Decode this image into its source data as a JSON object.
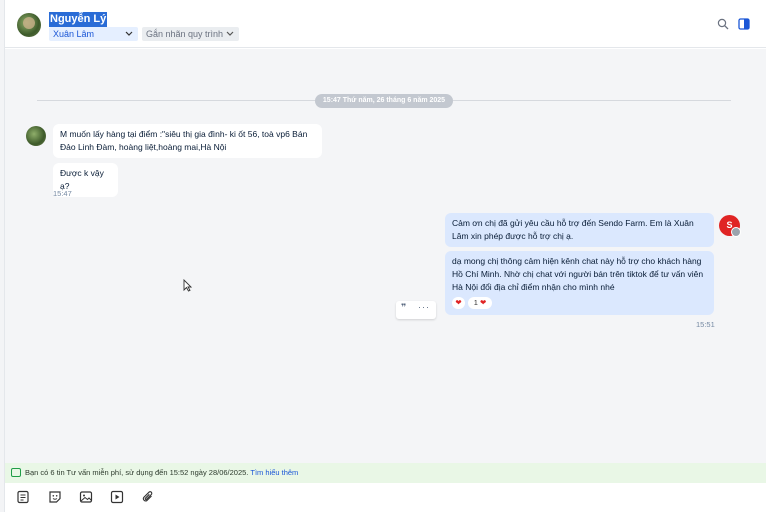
{
  "header": {
    "contact_name": "Nguyễn Lý",
    "assignee": "Xuân Lâm",
    "tag_placeholder": "Gắn nhãn quy trình"
  },
  "chat": {
    "date_separator": "15:47 Thứ năm, 26 tháng 6 năm 2025",
    "incoming": {
      "messages": [
        "M muốn lấy hàng tại điểm :\"siêu thị gia đình- ki ốt 56, toà vp6 Bán Đảo Linh Đàm, hoàng liệt,hoàng mai,Hà Nội",
        "Được k vậy ạ?"
      ],
      "time": "15:47"
    },
    "outgoing": {
      "avatar_text": "S",
      "messages": [
        "Cảm ơn chị đã gửi yêu cầu hỗ trợ đến Sendo Farm. Em là Xuân Lâm xin phép được hỗ trợ chị ạ.",
        "dạ mong chị thông cảm hiện kênh chat này hỗ trợ cho khách hàng Hồ Chí Minh. Nhờ chị chat với người bán trên tiktok để tư vấn viên Hà Nội đổi địa chỉ điểm nhận cho mình nhé"
      ],
      "reaction_count": "1",
      "time": "15:51"
    }
  },
  "notice": {
    "text": "Bạn có 6 tin Tư vấn miễn phí, sử dụng đến 15:52 ngày 28/06/2025.",
    "link": "Tìm hiểu thêm"
  },
  "colors": {
    "accent": "#1a56d6",
    "outgoing_bubble": "#dbe8fe",
    "background": "#f4f5f7",
    "notice_bg": "#e9f7e6"
  },
  "icons": [
    "search-icon",
    "panel-toggle-icon",
    "quote-icon",
    "more-icon",
    "heart-icon",
    "note-icon",
    "sticker-icon",
    "image-icon",
    "video-icon",
    "attachment-icon"
  ]
}
